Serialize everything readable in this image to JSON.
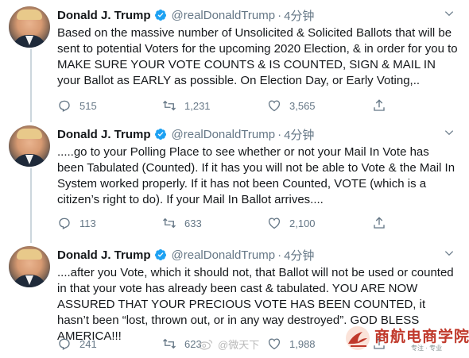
{
  "tweets": [
    {
      "name": "Donald J. Trump",
      "handle": "@realDonaldTrump",
      "separator": "·",
      "time": "4分钟",
      "text": "Based on the massive number of Unsolicited & Solicited Ballots that will be sent to potential Voters for the upcoming 2020 Election, & in order for you to MAKE SURE YOUR VOTE COUNTS & IS COUNTED, SIGN & MAIL IN your Ballot as EARLY as possible. On Election Day, or Early Voting,..",
      "replies": "515",
      "retweets": "1,231",
      "likes": "3,565"
    },
    {
      "name": "Donald J. Trump",
      "handle": "@realDonaldTrump",
      "separator": "·",
      "time": "4分钟",
      "text": ".....go to your Polling Place to see whether or not your Mail In Vote has been Tabulated (Counted). If it has you will not be able to Vote & the Mail In System worked properly. If it has not been Counted, VOTE (which is a citizen’s right to do). If your Mail In Ballot arrives....",
      "replies": "113",
      "retweets": "633",
      "likes": "2,100"
    },
    {
      "name": "Donald J. Trump",
      "handle": "@realDonaldTrump",
      "separator": "·",
      "time": "4分钟",
      "text": "....after you Vote, which it should not, that Ballot will not be used or counted in that your vote has already been cast & tabulated. YOU ARE NOW ASSURED THAT YOUR PRECIOUS VOTE HAS BEEN COUNTED, it hasn’t been “lost, thrown out, or in any way destroyed”. GOD BLESS AMERICA!!!",
      "replies": "241",
      "retweets": "623",
      "likes": "1,988"
    }
  ],
  "icons": {
    "verified": "verified-badge-icon",
    "caret": "chevron-down-icon",
    "reply": "reply-icon",
    "retweet": "retweet-icon",
    "like": "heart-icon",
    "share": "share-icon"
  },
  "colors": {
    "text": "#14171a",
    "muted": "#657786",
    "verified": "#1da1f2",
    "thread_line": "#ccd6dd",
    "logo_red": "#c0392b"
  },
  "watermarks": {
    "weibo_text": "@微天下",
    "logo_title": "商航电商学院",
    "logo_sub": "专注 · 专业"
  }
}
